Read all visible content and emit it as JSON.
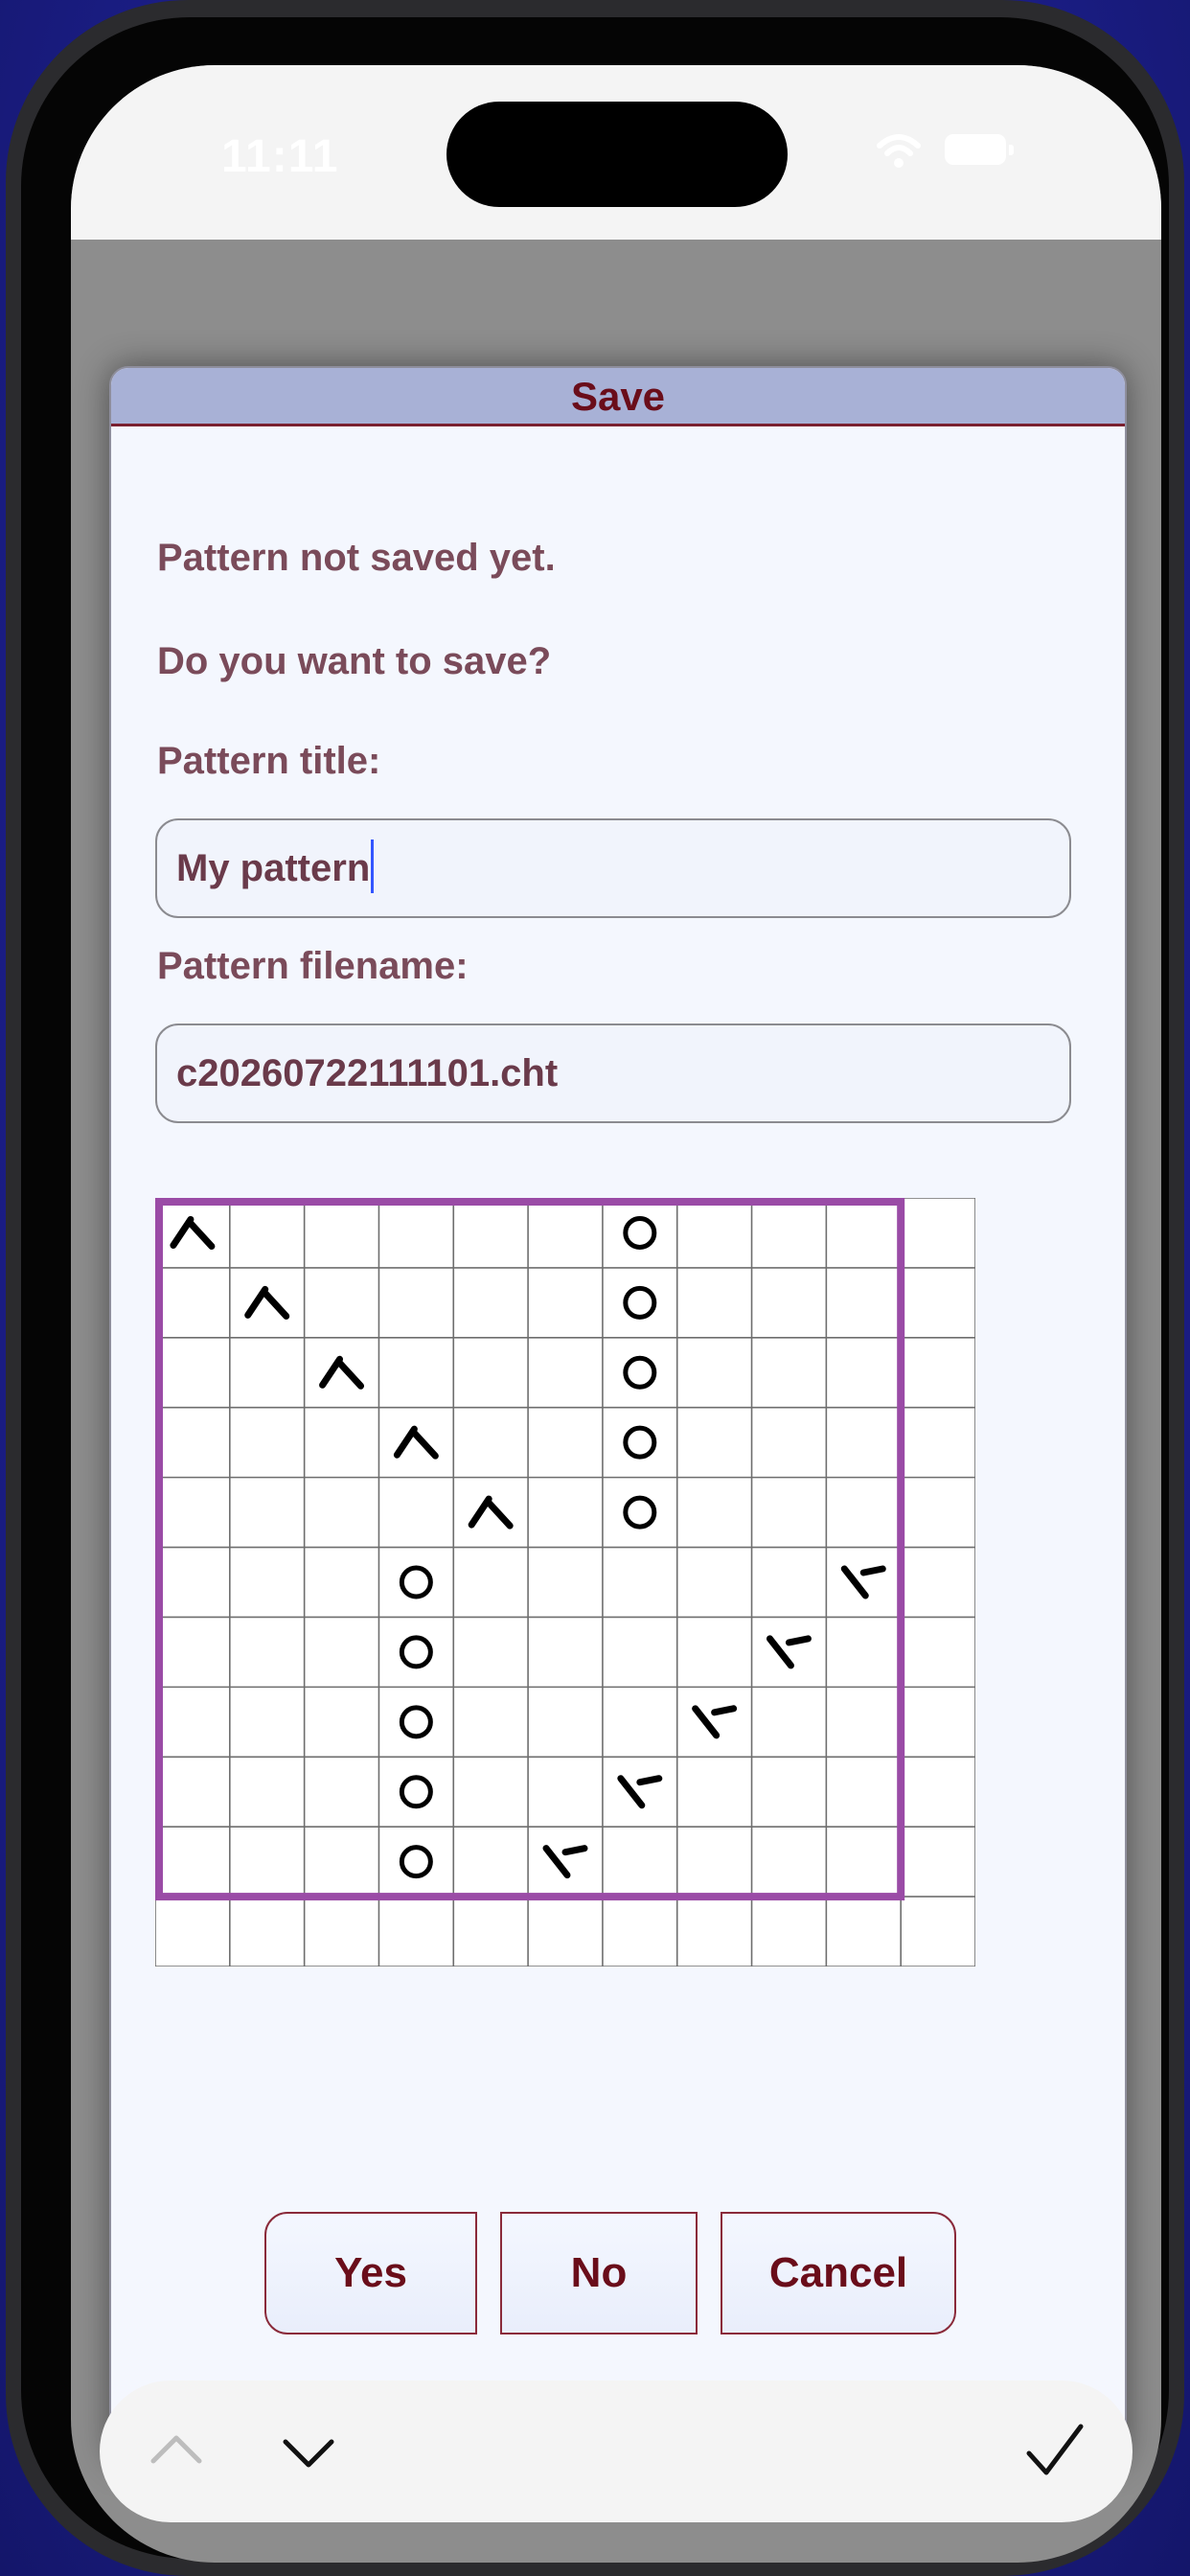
{
  "status_bar": {
    "time": "11:11",
    "wifi_icon": "wifi-icon",
    "battery_icon": "battery-icon"
  },
  "dialog": {
    "title": "Save",
    "message_line1": "Pattern not saved yet.",
    "message_line2": "Do you want to save?",
    "title_label": "Pattern title:",
    "title_value": "My pattern",
    "filename_label": "Pattern filename:",
    "filename_value": "c20260722111101.cht",
    "buttons": {
      "yes": "Yes",
      "no": "No",
      "cancel": "Cancel"
    }
  },
  "chart_grid": {
    "columns": 11,
    "rows": 11,
    "pattern_region": {
      "columns": 10,
      "rows": 10
    },
    "highlight_color": "#9a4ba6",
    "symbols": [
      {
        "row": 0,
        "col": 0,
        "type": "k2tog"
      },
      {
        "row": 1,
        "col": 1,
        "type": "k2tog"
      },
      {
        "row": 2,
        "col": 2,
        "type": "k2tog"
      },
      {
        "row": 3,
        "col": 3,
        "type": "k2tog"
      },
      {
        "row": 4,
        "col": 4,
        "type": "k2tog"
      },
      {
        "row": 0,
        "col": 6,
        "type": "yo"
      },
      {
        "row": 1,
        "col": 6,
        "type": "yo"
      },
      {
        "row": 2,
        "col": 6,
        "type": "yo"
      },
      {
        "row": 3,
        "col": 6,
        "type": "yo"
      },
      {
        "row": 4,
        "col": 6,
        "type": "yo"
      },
      {
        "row": 5,
        "col": 3,
        "type": "yo"
      },
      {
        "row": 6,
        "col": 3,
        "type": "yo"
      },
      {
        "row": 7,
        "col": 3,
        "type": "yo"
      },
      {
        "row": 8,
        "col": 3,
        "type": "yo"
      },
      {
        "row": 9,
        "col": 3,
        "type": "yo"
      },
      {
        "row": 5,
        "col": 9,
        "type": "ssk"
      },
      {
        "row": 6,
        "col": 8,
        "type": "ssk"
      },
      {
        "row": 7,
        "col": 7,
        "type": "ssk"
      },
      {
        "row": 8,
        "col": 6,
        "type": "ssk"
      },
      {
        "row": 9,
        "col": 5,
        "type": "ssk"
      }
    ]
  },
  "toolbar": {
    "up_icon": "chevron-up-icon",
    "down_icon": "chevron-down-icon",
    "done_icon": "checkmark-icon"
  }
}
